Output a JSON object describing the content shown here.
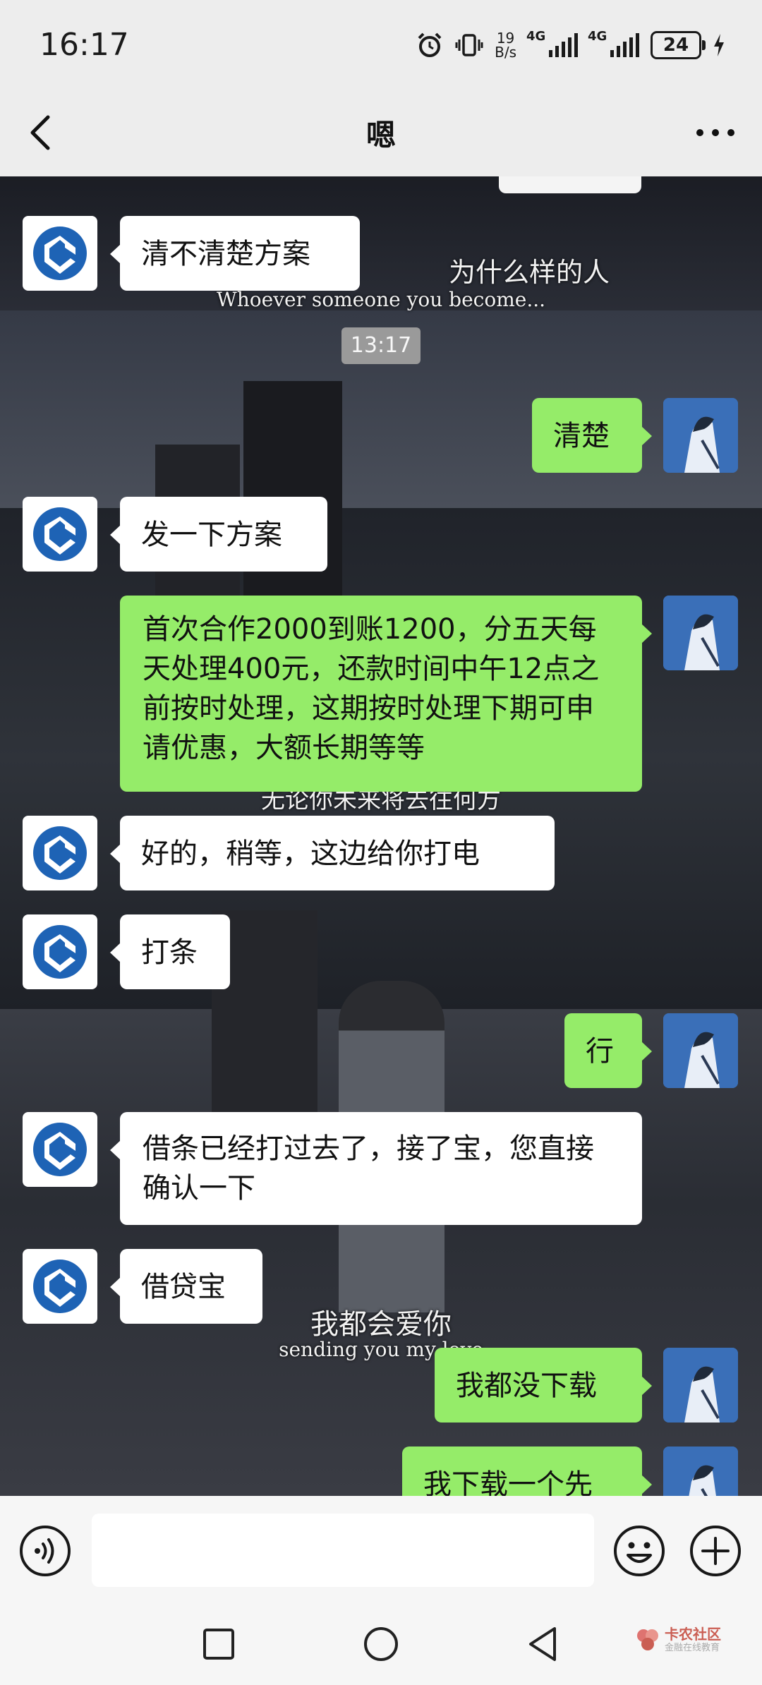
{
  "status_bar": {
    "time": "16:17",
    "net_speed_value": "19",
    "net_speed_unit": "B/s",
    "signal1_label": "4G",
    "signal2_label": "4G",
    "battery": "24"
  },
  "header": {
    "title": "嗯"
  },
  "chat_background": {
    "caption1_cn": "为什么样的人",
    "caption1_en": "Whoever someone you become...",
    "caption2_cn": "无论你未来将去往何方",
    "caption3_cn": "我都会爱你",
    "caption3_en": "sending you my love"
  },
  "chat": {
    "timestamp": "13:17",
    "messages": [
      {
        "sender": "contact",
        "text": "清不清楚方案"
      },
      {
        "sender": "me",
        "text": "清楚"
      },
      {
        "sender": "contact",
        "text": "发一下方案"
      },
      {
        "sender": "me",
        "text": "首次合作2000到账1200，分五天每天处理400元，还款时间中午12点之前按时处理，这期按时处理下期可申请优惠，大额长期等等"
      },
      {
        "sender": "contact",
        "text": "好的，稍等，这边给你打电"
      },
      {
        "sender": "contact",
        "text": "打条"
      },
      {
        "sender": "me",
        "text": "行"
      },
      {
        "sender": "contact",
        "text": "借条已经打过去了，接了宝，您直接确认一下"
      },
      {
        "sender": "contact",
        "text": "借贷宝"
      },
      {
        "sender": "me",
        "text": "我都没下载"
      },
      {
        "sender": "me",
        "text": "我下载一个先"
      }
    ]
  },
  "input_bar": {
    "value": "",
    "placeholder": ""
  },
  "watermark": {
    "name": "卡农社区",
    "sub": "金融在线教育"
  },
  "icons": {
    "back": "back-arrow-icon",
    "more": "more-dots-icon",
    "voice": "voice-icon",
    "emoji": "emoji-icon",
    "plus": "plus-icon",
    "bank_avatar": "bank-logo-icon",
    "user_avatar": "user-avatar"
  },
  "colors": {
    "outgoing_bubble": "#95ec69",
    "incoming_bubble": "#ffffff",
    "bank_logo": "#1e63b5"
  }
}
